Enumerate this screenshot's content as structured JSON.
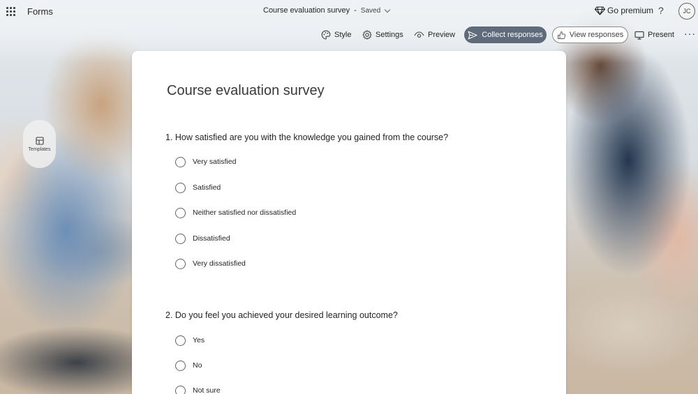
{
  "app": {
    "name": "Forms"
  },
  "document": {
    "title": "Course evaluation survey",
    "separator": "-",
    "status": "Saved"
  },
  "header": {
    "premium_label": "Go premium",
    "help_label": "?",
    "avatar_initials": "JC"
  },
  "commands": {
    "style": "Style",
    "settings": "Settings",
    "preview": "Preview",
    "collect": "Collect responses",
    "view": "View responses",
    "present": "Present",
    "more": "···"
  },
  "sidebar": {
    "templates_label": "Templates"
  },
  "form": {
    "title": "Course evaluation survey",
    "questions": [
      {
        "text": "1. How satisfied are you with the knowledge you gained from the course?",
        "options": [
          "Very satisfied",
          "Satisfied",
          "Neither satisfied nor dissatisfied",
          "Dissatisfied",
          "Very dissatisfied"
        ]
      },
      {
        "text": "2. Do you feel you achieved your desired learning outcome?",
        "options": [
          "Yes",
          "No",
          "Not sure"
        ]
      }
    ]
  },
  "colors": {
    "collect_button": "#5f6b7b",
    "card": "#ffffff"
  }
}
